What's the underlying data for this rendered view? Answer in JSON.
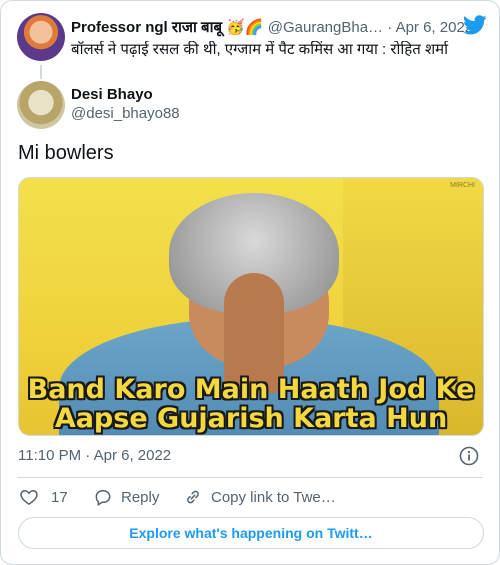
{
  "parent": {
    "name": "Professor ngl राजा बाबू 🥳🌈",
    "handle": "@GaurangBha…",
    "separator": "·",
    "date": "Apr 6, 2022",
    "text": "बॉलर्स ने पढ़ाई रसल की थी, एग्जाम में पैट कमिंस आ गया : रोहित शर्मा"
  },
  "author": {
    "name": "Desi Bhayo",
    "handle": "@desi_bhayo88"
  },
  "tweet": {
    "text": "Mi bowlers"
  },
  "media": {
    "caption_line1": "Band Karo Main Haath Jod Ke",
    "caption_line2": "Aapse Gujarish Karta Hun",
    "watermark": "MIRCHI"
  },
  "timestamp": "11:10 PM · Apr 6, 2022",
  "actions": {
    "like_count": "17",
    "reply_label": "Reply",
    "copy_label": "Copy link to Twe…"
  },
  "explore_label": "Explore what's happening on Twitt…",
  "colors": {
    "brand": "#1d9bf0",
    "text": "#0f1419",
    "muted": "#536471",
    "border": "#cfd9de",
    "caption": "#f4d83f"
  },
  "icons": [
    "twitter-bird-icon",
    "info-icon",
    "heart-icon",
    "reply-bubble-icon",
    "link-icon"
  ]
}
